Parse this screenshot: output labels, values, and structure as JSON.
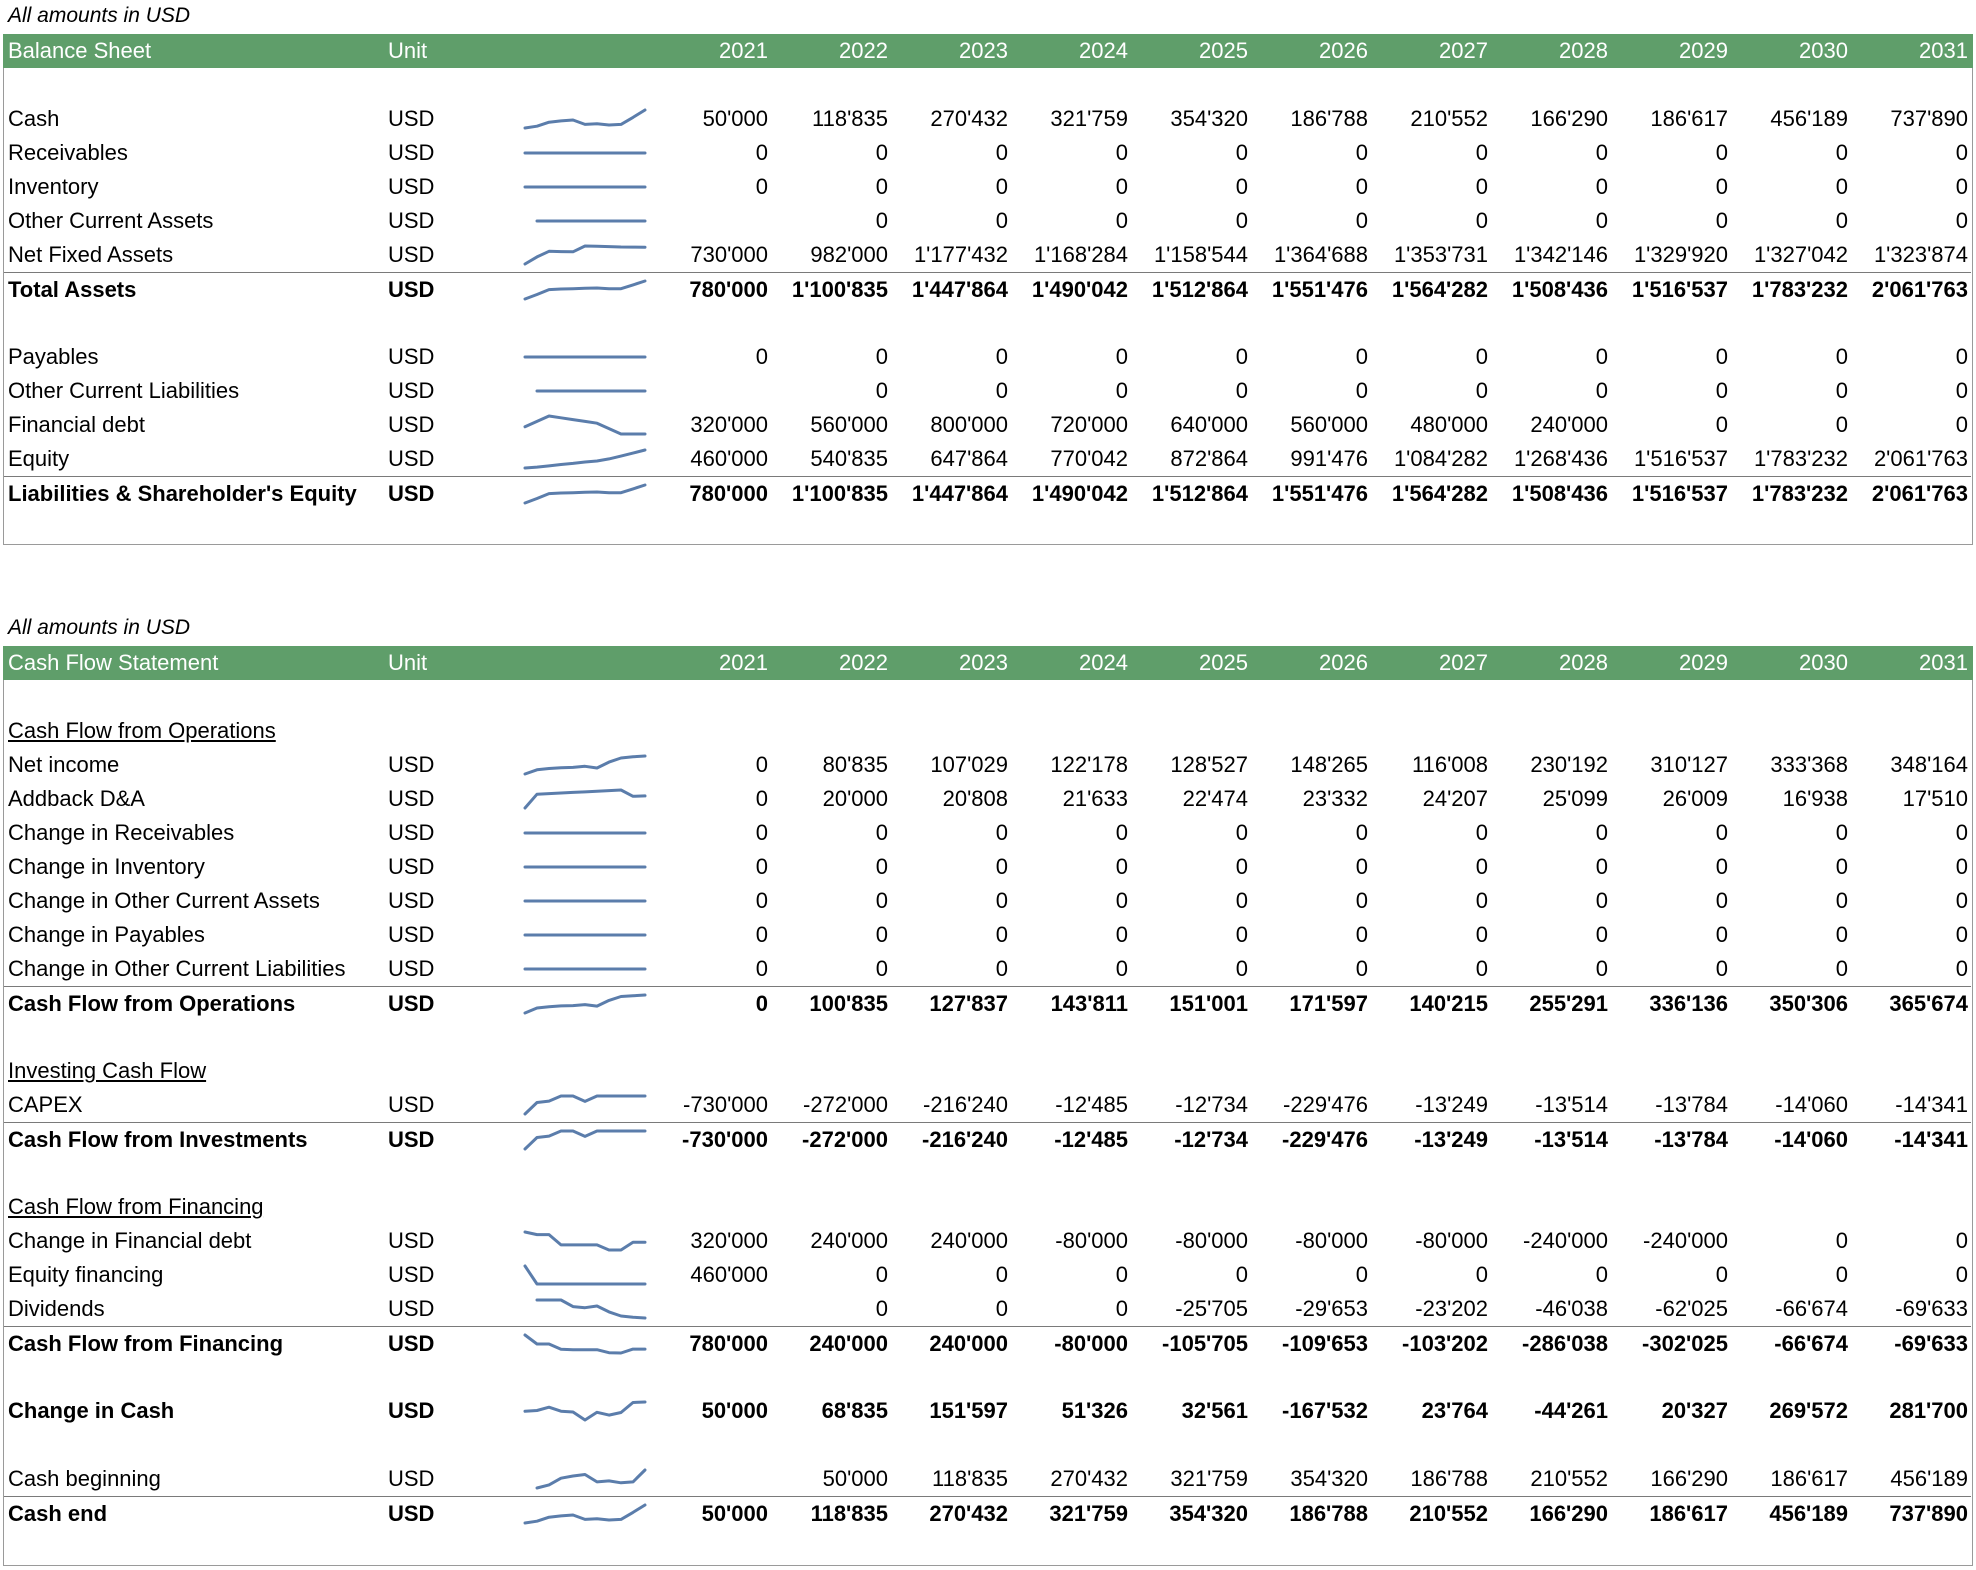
{
  "years": [
    "2021",
    "2022",
    "2023",
    "2024",
    "2025",
    "2026",
    "2027",
    "2028",
    "2029",
    "2030",
    "2031"
  ],
  "sections": [
    {
      "note": "All amounts in USD",
      "title": "Balance Sheet",
      "unit_header": "Unit",
      "rows": [
        {
          "type": "spacer"
        },
        {
          "label": "Cash",
          "unit": "USD",
          "values": [
            "50'000",
            "118'835",
            "270'432",
            "321'759",
            "354'320",
            "186'788",
            "210'552",
            "166'290",
            "186'617",
            "456'189",
            "737'890"
          ]
        },
        {
          "label": "Receivables",
          "unit": "USD",
          "values": [
            "0",
            "0",
            "0",
            "0",
            "0",
            "0",
            "0",
            "0",
            "0",
            "0",
            "0"
          ]
        },
        {
          "label": "Inventory",
          "unit": "USD",
          "values": [
            "0",
            "0",
            "0",
            "0",
            "0",
            "0",
            "0",
            "0",
            "0",
            "0",
            "0"
          ]
        },
        {
          "label": "Other Current Assets",
          "unit": "USD",
          "values": [
            "",
            "0",
            "0",
            "0",
            "0",
            "0",
            "0",
            "0",
            "0",
            "0",
            "0"
          ]
        },
        {
          "label": "Net Fixed Assets",
          "unit": "USD",
          "values": [
            "730'000",
            "982'000",
            "1'177'432",
            "1'168'284",
            "1'158'544",
            "1'364'688",
            "1'353'731",
            "1'342'146",
            "1'329'920",
            "1'327'042",
            "1'323'874"
          ]
        },
        {
          "label": "Total Assets",
          "unit": "USD",
          "bold": true,
          "topline": true,
          "values": [
            "780'000",
            "1'100'835",
            "1'447'864",
            "1'490'042",
            "1'512'864",
            "1'551'476",
            "1'564'282",
            "1'508'436",
            "1'516'537",
            "1'783'232",
            "2'061'763"
          ]
        },
        {
          "type": "spacer"
        },
        {
          "label": "Payables",
          "unit": "USD",
          "values": [
            "0",
            "0",
            "0",
            "0",
            "0",
            "0",
            "0",
            "0",
            "0",
            "0",
            "0"
          ]
        },
        {
          "label": "Other Current Liabilities",
          "unit": "USD",
          "values": [
            "",
            "0",
            "0",
            "0",
            "0",
            "0",
            "0",
            "0",
            "0",
            "0",
            "0"
          ]
        },
        {
          "label": "Financial debt",
          "unit": "USD",
          "values": [
            "320'000",
            "560'000",
            "800'000",
            "720'000",
            "640'000",
            "560'000",
            "480'000",
            "240'000",
            "0",
            "0",
            "0"
          ]
        },
        {
          "label": "Equity",
          "unit": "USD",
          "values": [
            "460'000",
            "540'835",
            "647'864",
            "770'042",
            "872'864",
            "991'476",
            "1'084'282",
            "1'268'436",
            "1'516'537",
            "1'783'232",
            "2'061'763"
          ]
        },
        {
          "label": "Liabilities & Shareholder's Equity",
          "unit": "USD",
          "bold": true,
          "topline": true,
          "values": [
            "780'000",
            "1'100'835",
            "1'447'864",
            "1'490'042",
            "1'512'864",
            "1'551'476",
            "1'564'282",
            "1'508'436",
            "1'516'537",
            "1'783'232",
            "2'061'763"
          ]
        }
      ]
    },
    {
      "note": "All amounts in USD",
      "title": "Cash Flow Statement",
      "unit_header": "Unit",
      "rows": [
        {
          "type": "spacer"
        },
        {
          "type": "section",
          "label": "Cash Flow from Operations"
        },
        {
          "label": "Net income",
          "unit": "USD",
          "values": [
            "0",
            "80'835",
            "107'029",
            "122'178",
            "128'527",
            "148'265",
            "116'008",
            "230'192",
            "310'127",
            "333'368",
            "348'164"
          ]
        },
        {
          "label": "Addback D&A",
          "unit": "USD",
          "values": [
            "0",
            "20'000",
            "20'808",
            "21'633",
            "22'474",
            "23'332",
            "24'207",
            "25'099",
            "26'009",
            "16'938",
            "17'510"
          ]
        },
        {
          "label": "Change in Receivables",
          "unit": "USD",
          "values": [
            "0",
            "0",
            "0",
            "0",
            "0",
            "0",
            "0",
            "0",
            "0",
            "0",
            "0"
          ]
        },
        {
          "label": "Change in Inventory",
          "unit": "USD",
          "values": [
            "0",
            "0",
            "0",
            "0",
            "0",
            "0",
            "0",
            "0",
            "0",
            "0",
            "0"
          ]
        },
        {
          "label": "Change in Other Current Assets",
          "unit": "USD",
          "values": [
            "0",
            "0",
            "0",
            "0",
            "0",
            "0",
            "0",
            "0",
            "0",
            "0",
            "0"
          ]
        },
        {
          "label": "Change in Payables",
          "unit": "USD",
          "values": [
            "0",
            "0",
            "0",
            "0",
            "0",
            "0",
            "0",
            "0",
            "0",
            "0",
            "0"
          ]
        },
        {
          "label": "Change in Other Current Liabilities",
          "unit": "USD",
          "values": [
            "0",
            "0",
            "0",
            "0",
            "0",
            "0",
            "0",
            "0",
            "0",
            "0",
            "0"
          ]
        },
        {
          "label": "Cash Flow from Operations",
          "unit": "USD",
          "bold": true,
          "topline": true,
          "values": [
            "0",
            "100'835",
            "127'837",
            "143'811",
            "151'001",
            "171'597",
            "140'215",
            "255'291",
            "336'136",
            "350'306",
            "365'674"
          ]
        },
        {
          "type": "spacer"
        },
        {
          "type": "section",
          "label": "Investing Cash Flow"
        },
        {
          "label": "CAPEX",
          "unit": "USD",
          "values": [
            "-730'000",
            "-272'000",
            "-216'240",
            "-12'485",
            "-12'734",
            "-229'476",
            "-13'249",
            "-13'514",
            "-13'784",
            "-14'060",
            "-14'341"
          ]
        },
        {
          "label": "Cash Flow from Investments",
          "unit": "USD",
          "bold": true,
          "topline": true,
          "values": [
            "-730'000",
            "-272'000",
            "-216'240",
            "-12'485",
            "-12'734",
            "-229'476",
            "-13'249",
            "-13'514",
            "-13'784",
            "-14'060",
            "-14'341"
          ]
        },
        {
          "type": "spacer"
        },
        {
          "type": "section",
          "label": "Cash Flow from Financing"
        },
        {
          "label": "Change in Financial debt",
          "unit": "USD",
          "values": [
            "320'000",
            "240'000",
            "240'000",
            "-80'000",
            "-80'000",
            "-80'000",
            "-80'000",
            "-240'000",
            "-240'000",
            "0",
            "0"
          ]
        },
        {
          "label": "Equity financing",
          "unit": "USD",
          "values": [
            "460'000",
            "0",
            "0",
            "0",
            "0",
            "0",
            "0",
            "0",
            "0",
            "0",
            "0"
          ]
        },
        {
          "label": "Dividends",
          "unit": "USD",
          "values": [
            "",
            "0",
            "0",
            "0",
            "-25'705",
            "-29'653",
            "-23'202",
            "-46'038",
            "-62'025",
            "-66'674",
            "-69'633"
          ]
        },
        {
          "label": "Cash Flow from Financing",
          "unit": "USD",
          "bold": true,
          "topline": true,
          "values": [
            "780'000",
            "240'000",
            "240'000",
            "-80'000",
            "-105'705",
            "-109'653",
            "-103'202",
            "-286'038",
            "-302'025",
            "-66'674",
            "-69'633"
          ]
        },
        {
          "type": "spacer"
        },
        {
          "label": "Change in Cash",
          "unit": "USD",
          "bold": true,
          "values": [
            "50'000",
            "68'835",
            "151'597",
            "51'326",
            "32'561",
            "-167'532",
            "23'764",
            "-44'261",
            "20'327",
            "269'572",
            "281'700"
          ]
        },
        {
          "type": "spacer"
        },
        {
          "label": "Cash beginning",
          "unit": "USD",
          "values": [
            "",
            "50'000",
            "118'835",
            "270'432",
            "321'759",
            "354'320",
            "186'788",
            "210'552",
            "166'290",
            "186'617",
            "456'189"
          ]
        },
        {
          "label": "Cash end",
          "unit": "USD",
          "bold": true,
          "topline": true,
          "values": [
            "50'000",
            "118'835",
            "270'432",
            "321'759",
            "354'320",
            "186'788",
            "210'552",
            "166'290",
            "186'617",
            "456'189",
            "737'890"
          ]
        }
      ]
    }
  ]
}
